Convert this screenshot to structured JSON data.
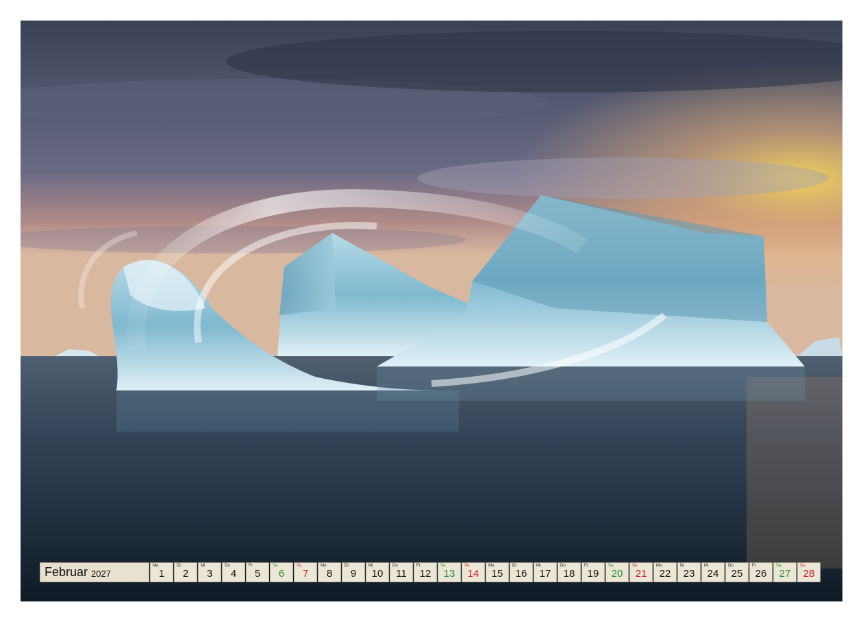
{
  "calendar": {
    "month": "Februar",
    "year": "2027",
    "colors": {
      "saturday": "#1f8f2a",
      "sunday": "#cc1b1b",
      "cell_bg": "#ece6d6"
    },
    "days": [
      {
        "wd": "Mo",
        "num": "1",
        "kind": "weekday"
      },
      {
        "wd": "Di",
        "num": "2",
        "kind": "weekday"
      },
      {
        "wd": "Mi",
        "num": "3",
        "kind": "weekday"
      },
      {
        "wd": "Do",
        "num": "4",
        "kind": "weekday"
      },
      {
        "wd": "Fr",
        "num": "5",
        "kind": "weekday"
      },
      {
        "wd": "Sa",
        "num": "6",
        "kind": "sat"
      },
      {
        "wd": "So",
        "num": "7",
        "kind": "sun"
      },
      {
        "wd": "Mo",
        "num": "8",
        "kind": "weekday"
      },
      {
        "wd": "Di",
        "num": "9",
        "kind": "weekday"
      },
      {
        "wd": "Mi",
        "num": "10",
        "kind": "weekday"
      },
      {
        "wd": "Do",
        "num": "11",
        "kind": "weekday"
      },
      {
        "wd": "Fr",
        "num": "12",
        "kind": "weekday"
      },
      {
        "wd": "Sa",
        "num": "13",
        "kind": "sat"
      },
      {
        "wd": "So",
        "num": "14",
        "kind": "sun"
      },
      {
        "wd": "Mo",
        "num": "15",
        "kind": "weekday"
      },
      {
        "wd": "Di",
        "num": "16",
        "kind": "weekday"
      },
      {
        "wd": "Mi",
        "num": "17",
        "kind": "weekday"
      },
      {
        "wd": "Do",
        "num": "18",
        "kind": "weekday"
      },
      {
        "wd": "Fr",
        "num": "19",
        "kind": "weekday"
      },
      {
        "wd": "Sa",
        "num": "20",
        "kind": "sat"
      },
      {
        "wd": "So",
        "num": "21",
        "kind": "sun"
      },
      {
        "wd": "Mo",
        "num": "22",
        "kind": "weekday"
      },
      {
        "wd": "Di",
        "num": "23",
        "kind": "weekday"
      },
      {
        "wd": "Mi",
        "num": "24",
        "kind": "weekday"
      },
      {
        "wd": "Do",
        "num": "25",
        "kind": "weekday"
      },
      {
        "wd": "Fr",
        "num": "26",
        "kind": "weekday"
      },
      {
        "wd": "Sa",
        "num": "27",
        "kind": "sat"
      },
      {
        "wd": "So",
        "num": "28",
        "kind": "sun"
      }
    ]
  }
}
